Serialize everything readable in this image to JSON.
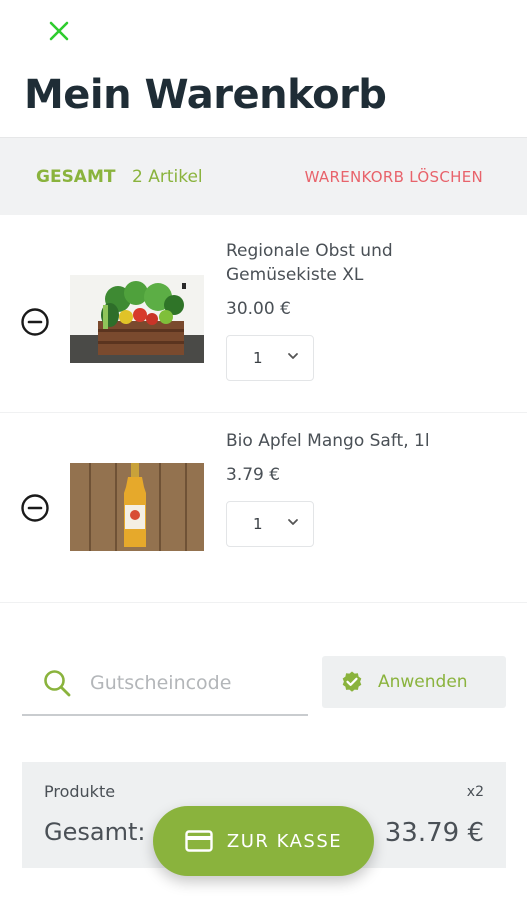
{
  "header": {
    "close_icon": "close-icon",
    "title": "Mein Warenkorb"
  },
  "summary": {
    "label": "GESAMT",
    "count": "2 Artikel",
    "clear_label": "WARENKORB LÖSCHEN"
  },
  "items": [
    {
      "name": "Regionale Obst und Gemüsekiste XL",
      "price": "30.00 €",
      "quantity": "1",
      "image": "vegetable-crate-photo",
      "remove_icon": "minus-circle-icon"
    },
    {
      "name": "Bio Apfel Mango Saft, 1l",
      "price": "3.79 €",
      "quantity": "1",
      "image": "juice-bottle-photo",
      "remove_icon": "minus-circle-icon"
    }
  ],
  "coupon": {
    "placeholder": "Gutscheincode",
    "icon": "search-icon",
    "apply_label": "Anwenden",
    "apply_icon": "check-badge-icon"
  },
  "totals": {
    "products_label": "Produkte",
    "products_count": "x2",
    "total_label": "Gesamt:",
    "total_value": "33.79 €"
  },
  "checkout": {
    "label": "ZUR KASSE",
    "icon": "credit-card-icon"
  },
  "colors": {
    "accent_green": "#8ab33d",
    "danger_red": "#e8636b",
    "close_green": "#2ecc2e",
    "title_dark": "#1f2d36"
  }
}
